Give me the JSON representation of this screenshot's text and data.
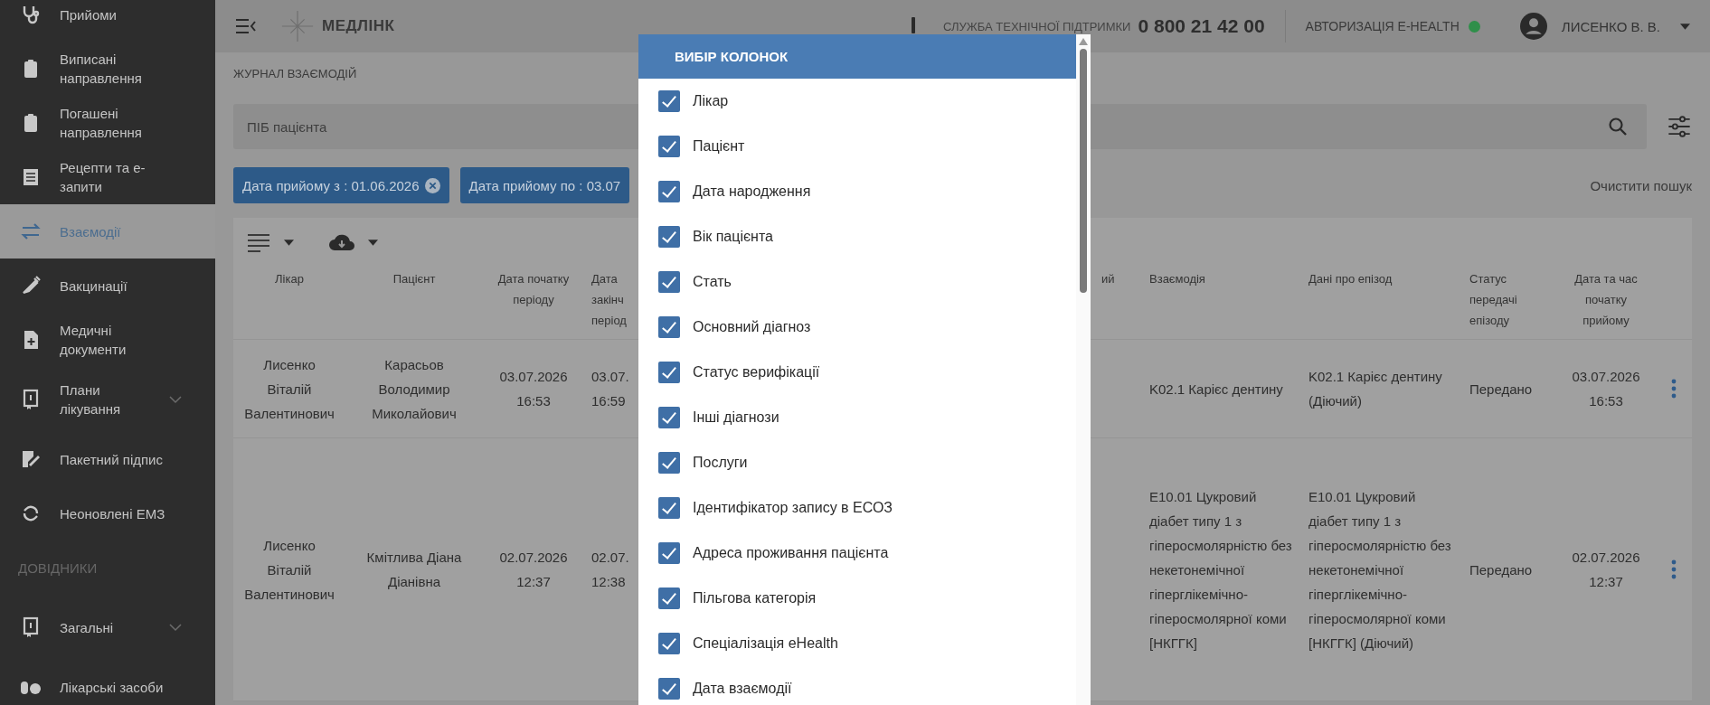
{
  "sidebar": {
    "items": [
      {
        "label": "Прийоми",
        "selected": false,
        "expandable": false
      },
      {
        "label": "Виписані направлення",
        "selected": false,
        "expandable": false
      },
      {
        "label": "Погашені направлення",
        "selected": false,
        "expandable": false
      },
      {
        "label": "Рецепти та е-запити",
        "selected": false,
        "expandable": false
      },
      {
        "label": "Взаємодії",
        "selected": true,
        "expandable": false
      },
      {
        "label": "Вакцинації",
        "selected": false,
        "expandable": false
      },
      {
        "label": "Медичні документи",
        "selected": false,
        "expandable": false
      },
      {
        "label": "Плани лікування",
        "selected": false,
        "expandable": true
      },
      {
        "label": "Пакетний підпис",
        "selected": false,
        "expandable": false
      },
      {
        "label": "Неоновлені ЕМЗ",
        "selected": false,
        "expandable": false
      }
    ],
    "section_title": "ДОВІДНИКИ",
    "section_items": [
      {
        "label": "Загальні",
        "selected": false,
        "expandable": true
      },
      {
        "label": "Лікарські засоби",
        "selected": false,
        "expandable": false
      }
    ]
  },
  "header": {
    "logo_text": "МЕДЛІНК",
    "support_label": "СЛУЖБА ТЕХНІЧНОЇ ПІДТРИМКИ",
    "support_phone": "0 800 21 42 00",
    "auth_label": "АВТОРИЗАЦІЯ E-HEALTH",
    "auth_ok": true,
    "user_name": "ЛИСЕНКО В. В."
  },
  "breadcrumb": "ЖУРНАЛ ВЗАЄМОДІЙ",
  "search": {
    "placeholder": "ПІБ пацієнта"
  },
  "filter_chips": [
    {
      "label": "Дата прийому з : 01.06.2026",
      "removable": true
    },
    {
      "label": "Дата прийому по : 03.07",
      "removable": false
    }
  ],
  "clear_search": "Очистити пошук",
  "table": {
    "left_columns": [
      "Лікар",
      "Пацієнт",
      "Дата початку періоду",
      "Дата закінч період"
    ],
    "covered_column_fragment": "ий",
    "right_columns": [
      "Взаємодія",
      "Дані про епізод",
      "Статус передачі епізоду",
      "Дата та час початку прийому"
    ],
    "rows": [
      {
        "left": [
          "Лисенко Віталій Валентинович",
          "Карасьов Володимир Миколайович",
          "03.07.2026 16:53",
          "03.07. 16:59"
        ],
        "right": [
          "K02.1 Карієс дентину",
          "K02.1 Карієс дентину (Діючий)",
          "Передано",
          "03.07.2026 16:53"
        ]
      },
      {
        "left": [
          "Лисенко Віталій Валентинович",
          "Кмітлива Діана Діанівна",
          "02.07.2026 12:37",
          "02.07. 12:38"
        ],
        "right": [
          "E10.01 Цукровий діабет типу 1 з гіперосмолярністю без некетонемічної гіперглікемічно-гіперосмолярної коми [НКГГК]",
          "E10.01 Цукровий діабет типу 1 з гіперосмолярністю без некетонемічної гіперглікемічно-гіперосмолярної коми [НКГГК] (Діючий)",
          "Передано",
          "02.07.2026 12:37"
        ]
      }
    ]
  },
  "dialog": {
    "title": "ВИБІР КОЛОНОК",
    "items": [
      {
        "label": "Лікар",
        "checked": true
      },
      {
        "label": "Пацієнт",
        "checked": true
      },
      {
        "label": "Дата народження",
        "checked": true
      },
      {
        "label": "Вік пацієнта",
        "checked": true
      },
      {
        "label": "Стать",
        "checked": true
      },
      {
        "label": "Основний діагноз",
        "checked": true
      },
      {
        "label": "Статус верифікації",
        "checked": true
      },
      {
        "label": "Інші діагнози",
        "checked": true
      },
      {
        "label": "Послуги",
        "checked": true
      },
      {
        "label": "Ідентифікатор запису в ЕСОЗ",
        "checked": true
      },
      {
        "label": "Адреса проживання пацієнта",
        "checked": true
      },
      {
        "label": "Пільгова категорія",
        "checked": true
      },
      {
        "label": "Спеціалізація eHealth",
        "checked": true
      },
      {
        "label": "Дата взаємодії",
        "checked": true
      }
    ]
  }
}
